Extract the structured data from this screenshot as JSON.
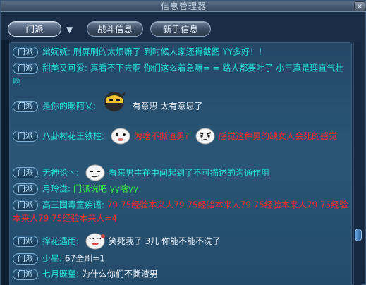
{
  "window": {
    "title": "信息管理器",
    "close_label": "×"
  },
  "tabs": {
    "sect": "门派",
    "battle": "战斗信息",
    "newbie": "新手信息"
  },
  "badge_label": "门派",
  "messages": [
    {
      "name": "棠妩妩:",
      "text": "刷屏刷的太烦嘛了 到时候人家还得截图 YY多好！！",
      "color": "cyan"
    },
    {
      "name": "甜美又可爱:",
      "text": "真看不下去啊  你们这么着急嘛= =  路人都要吐了  小三真是理直气壮啊",
      "color": "cyan"
    },
    {
      "name": "是你的暖阿乂:",
      "text": "有意思 太有意思了",
      "color": "white"
    },
    {
      "name": "八卦村花王铁柱:",
      "text1": "为啥不撕渣男?",
      "text2": "感觉这种男的缺女人会死的感觉",
      "color": "red"
    },
    {
      "name": "无神论丶:",
      "text": "看来男主在中间起到了不可描述的沟通作用",
      "color": "cyan"
    },
    {
      "name": "月玲泷:",
      "text": "门派说吧 yy啥yy",
      "color": "green"
    },
    {
      "name": "高三围毒童疾语:",
      "text": "79 75经验本来人79 75经验本来人79 75经验本来人79 75经验本来人79 75经验本来人=4",
      "color": "red"
    },
    {
      "name": "撑花遇雨:",
      "text": "笑死我了  3儿  你能不能不洗了",
      "color": "white"
    },
    {
      "name": "少星:",
      "text": "67全刷=1",
      "color": "white"
    },
    {
      "name": "七月既望:",
      "text": "为什么你们不撕渣男",
      "color": "white"
    }
  ],
  "colors": {
    "cyan": "#27e0d6",
    "white": "#e8eef6",
    "green": "#39f34a",
    "red": "#ff2a2a"
  }
}
